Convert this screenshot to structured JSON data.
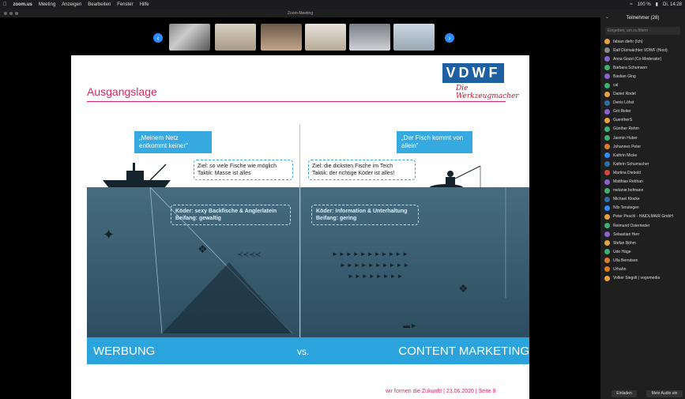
{
  "menubar": {
    "app": "zoom.us",
    "items": [
      "Meeting",
      "Anzeigen",
      "Bearbeiten",
      "Fenster",
      "Hilfe"
    ],
    "battery": "100 %",
    "clock": "Di. 14:28"
  },
  "window": {
    "title": "Zoom-Meeting"
  },
  "slide": {
    "title": "Ausgangslage",
    "logo": "VDWF",
    "tagline": "Die Werkzeugmacher",
    "left_bubble": "„Meinem Netz entkommt keiner\"",
    "right_bubble": "„Der Fisch kommt von allein\"",
    "left_goal": "Ziel: so viele Fische wie möglich",
    "left_tactic": "Taktik: Masse ist alles",
    "right_goal": "Ziel: die dicksten Fische im Teich",
    "right_tactic": "Taktik: der richtige Köder ist alles!",
    "left_bait": "Köder: sexy Backfische & Anglerlatein",
    "left_catch": "Beifang: gewaltig",
    "right_bait": "Köder: Information & Unterhaltung",
    "right_catch": "Beifang: gering",
    "bar_left": "WERBUNG",
    "bar_mid": "vs.",
    "bar_right": "CONTENT MARKETING",
    "footer": "wir formen die Zukunft! | 23.06.2020 | Seite 8"
  },
  "participants": {
    "header": "Teilnehmer (28)",
    "search_placeholder": "Eingeben, um zu filtern",
    "list": [
      {
        "initials": "f",
        "name": "fabian diehr (Ich)",
        "color": "#e8a33c"
      },
      {
        "initials": "R",
        "name": "Ralf Dürrwächter VDWF (Host)",
        "color": "#888888"
      },
      {
        "initials": "AG",
        "name": "Anna Gozzi (Co-Moderator)",
        "color": "#8a63d2"
      },
      {
        "initials": "BS",
        "name": "Barbara Schumann",
        "color": "#3bb273"
      },
      {
        "initials": "BG",
        "name": "Bastian Ging",
        "color": "#8a63d2"
      },
      {
        "initials": "c",
        "name": "cal",
        "color": "#3bb273"
      },
      {
        "initials": "D",
        "name": "Daniel Rodel",
        "color": "#e8a33c"
      },
      {
        "initials": "DL",
        "name": "Denis Löhst",
        "color": "#2d6fa6"
      },
      {
        "initials": "GR",
        "name": "Grit Reiter",
        "color": "#8a63d2"
      },
      {
        "initials": "G",
        "name": "GuentherS",
        "color": "#e8a33c"
      },
      {
        "initials": "GR",
        "name": "Günther Rehm",
        "color": "#3bb273"
      },
      {
        "initials": "JH",
        "name": "Jasmin Huber",
        "color": "#3bb273"
      },
      {
        "initials": "JP",
        "name": "Johannes Peter",
        "color": "#e07b1f"
      },
      {
        "initials": "KM",
        "name": "Kathrin Micke",
        "color": "#2d8cff"
      },
      {
        "initials": "KS",
        "name": "Kathrin Schumacher",
        "color": "#2d6fa6"
      },
      {
        "initials": "MD",
        "name": "Martina Diebold",
        "color": "#d9433a"
      },
      {
        "initials": "MR",
        "name": "Matthias Rebhan",
        "color": "#8a63d2"
      },
      {
        "initials": "m",
        "name": "melanie.hofmann",
        "color": "#3bb273"
      },
      {
        "initials": "MK",
        "name": "Michael Klocke",
        "color": "#2d6fa6"
      },
      {
        "initials": "NT",
        "name": "Nils Tenstegen",
        "color": "#2d8cff"
      },
      {
        "initials": "PP",
        "name": "Peter Peschl - HAIDLMAIR GmbH",
        "color": "#e8a33c"
      },
      {
        "initials": "RO",
        "name": "Reimund Osterrieder",
        "color": "#3bb273"
      },
      {
        "initials": "SH",
        "name": "Sebastian Herr",
        "color": "#8a63d2"
      },
      {
        "initials": "SB",
        "name": "Stefan Böhm",
        "color": "#e8a33c"
      },
      {
        "initials": "UH",
        "name": "Udo Häge",
        "color": "#3bb273"
      },
      {
        "initials": "UB",
        "name": "Ulla Berndsen",
        "color": "#e07b1f"
      },
      {
        "initials": "U",
        "name": "Urhahn",
        "color": "#e07b1f"
      },
      {
        "initials": "VS",
        "name": "Volker Siegolt | vogomedia",
        "color": "#e8a33c"
      }
    ],
    "invite_label": "Einladen",
    "mute_label": "Mein Audio ein"
  }
}
